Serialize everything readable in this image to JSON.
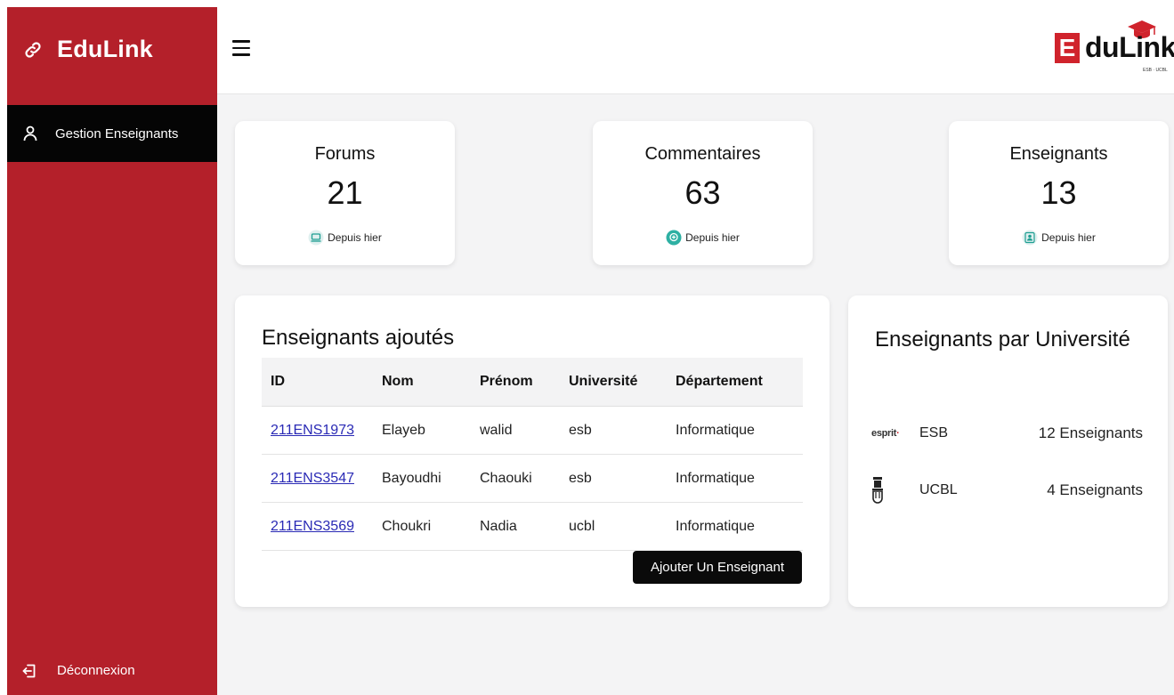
{
  "sidebar": {
    "brand": "EduLink",
    "nav_items": [
      {
        "label": "Gestion Enseignants"
      }
    ],
    "logout_label": "Déconnexion"
  },
  "header": {
    "logo_letter": "E",
    "logo_word": "duLink",
    "logo_sub": "ESB · UCBL"
  },
  "stats": [
    {
      "title": "Forums",
      "value": "21",
      "sub": "Depuis hier"
    },
    {
      "title": "Commentaires",
      "value": "63",
      "sub": "Depuis hier"
    },
    {
      "title": "Enseignants",
      "value": "13",
      "sub": "Depuis hier"
    }
  ],
  "teachers_table": {
    "title": "Enseignants ajoutés",
    "columns": [
      "ID",
      "Nom",
      "Prénom",
      "Université",
      "Département"
    ],
    "rows": [
      [
        "211ENS1973",
        "Elayeb",
        "walid",
        "esb",
        "Informatique"
      ],
      [
        "211ENS3547",
        "Bayoudhi",
        "Chaouki",
        "esb",
        "Informatique"
      ],
      [
        "211ENS3569",
        "Choukri",
        "Nadia",
        "ucbl",
        "Informatique"
      ]
    ],
    "add_button": "Ajouter Un Enseignant"
  },
  "universities": {
    "title": "Enseignants par Université",
    "items": [
      {
        "name": "ESB",
        "count": "12 Enseignants",
        "logo_text_main": "esprit",
        "logo_text_accent": "·"
      },
      {
        "name": "UCBL",
        "count": "4 Enseignants"
      }
    ]
  },
  "colors": {
    "sidebar_red": "#b4202a",
    "active_nav": "#050505",
    "link_blue": "#2a2ab5",
    "button_black": "#0a0a0a"
  }
}
